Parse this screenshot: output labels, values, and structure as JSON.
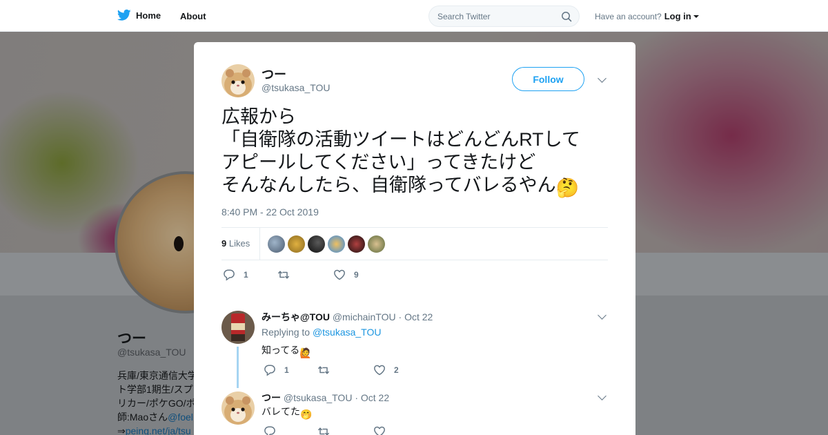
{
  "nav": {
    "home_label": "Home",
    "about_label": "About",
    "search_placeholder": "Search Twitter",
    "have_account": "Have an account?",
    "login_label": "Log in"
  },
  "background_profile": {
    "name": "つー",
    "handle": "@tsukasa_TOU",
    "bio_lines": [
      "兵庫/東京通信大学",
      "ト学部1期生/スプ",
      "リカー/ポケGO/ポ",
      "師:Maoさん",
      "⇒"
    ],
    "bio_link_1": "@foel",
    "bio_link_2": "peing.net/ja/tsu"
  },
  "tweet": {
    "author_name": "つー",
    "author_handle": "@tsukasa_TOU",
    "follow_label": "Follow",
    "text": "広報から\n「自衛隊の活動ツイートはどんどんRTして\nアピールしてください」ってきたけど\nそんなんしたら、自衛隊ってバレるやん",
    "text_emoji": "🤔",
    "timestamp": "8:40 PM - 22 Oct 2019",
    "likes_count": "9",
    "likes_label": "Likes",
    "reply_count": "1",
    "retweet_count": "",
    "like_count": "9"
  },
  "replies": [
    {
      "name": "みーちゃ@TOU",
      "handle": "@michainTOU",
      "date": "Oct 22",
      "replying_to_label": "Replying to",
      "replying_to": "@tsukasa_TOU",
      "text": "知ってる",
      "emoji": "🙋",
      "reply_count": "1",
      "retweet_count": "",
      "like_count": "2"
    },
    {
      "name": "つー",
      "handle": "@tsukasa_TOU",
      "date": "Oct 22",
      "text": "バレてた",
      "emoji": "🤭",
      "reply_count": "",
      "retweet_count": "",
      "like_count": ""
    }
  ],
  "colors": {
    "twitter_blue": "#1da1f2",
    "link_blue": "#1b95e0",
    "muted_text": "#657786",
    "thread_line": "#a6d4f2"
  }
}
